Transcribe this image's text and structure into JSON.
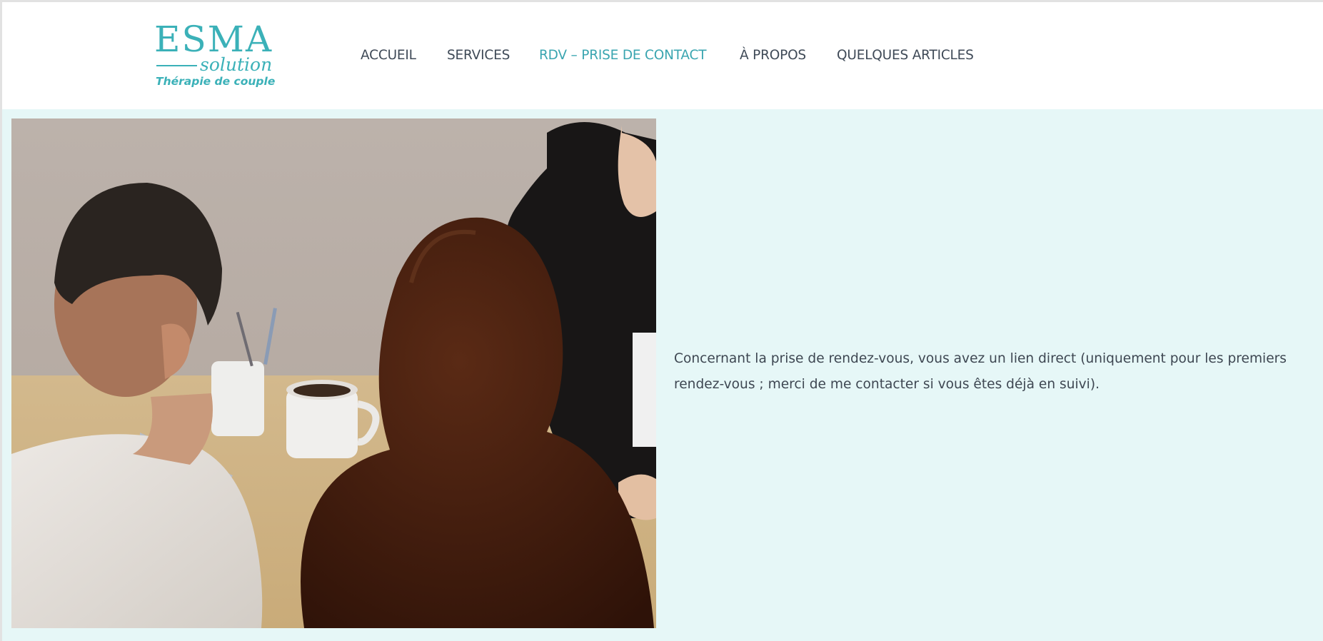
{
  "logo": {
    "main": "ESMA",
    "sub": "solution",
    "tagline": "Thérapie de couple"
  },
  "nav": {
    "items": [
      {
        "label": "ACCUEIL",
        "active": false
      },
      {
        "label": "SERVICES",
        "active": false
      },
      {
        "label": "RDV – PRISE DE CONTACT",
        "active": true
      },
      {
        "label": "À PROPOS",
        "active": false
      },
      {
        "label": "QUELQUES ARTICLES",
        "active": false
      }
    ]
  },
  "content": {
    "text": "Concernant la prise de rendez-vous, vous avez un lien direct (uniquement pour les premiers rendez-vous ; merci de me contacter si vous êtes déjà en suivi)."
  },
  "colors": {
    "brand": "#3bb1b8",
    "nav_text": "#3f4a57",
    "nav_active": "#3aa5b0",
    "band_background": "#e6f7f7",
    "body_text": "#3e4752"
  }
}
